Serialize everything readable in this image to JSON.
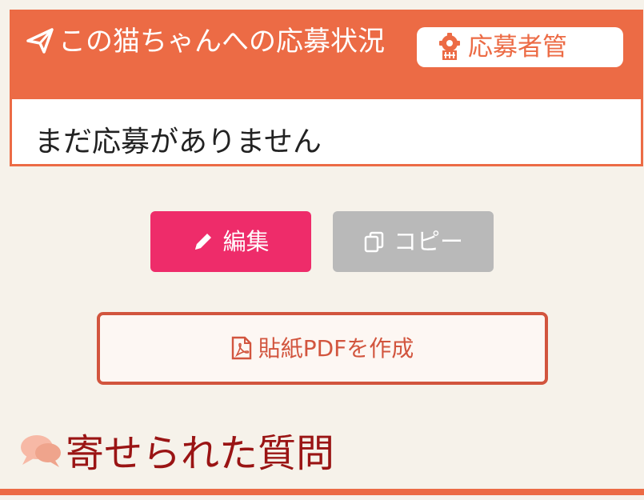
{
  "application_status": {
    "title": "この猫ちゃんへの応募状況",
    "manage_button_label": "応募者管",
    "empty_message": "まだ応募がありません"
  },
  "actions": {
    "edit_label": "編集",
    "copy_label": "コピー",
    "pdf_label": "貼紙PDFを作成"
  },
  "questions": {
    "heading": "寄せられた質問"
  },
  "icons": {
    "title_icon": "paper-plane-icon",
    "manage_icon": "gear-icon",
    "edit_icon": "pencil-icon",
    "copy_icon": "copy-icon",
    "pdf_icon": "pdf-file-icon",
    "questions_icon": "chat-bubbles-icon"
  },
  "colors": {
    "accent": "#ec6b45",
    "edit_button": "#ee2c6a",
    "copy_button": "#b9b9b9",
    "pdf_border": "#d2553e",
    "heading_text": "#9a1414",
    "background": "#f6f2ea"
  }
}
